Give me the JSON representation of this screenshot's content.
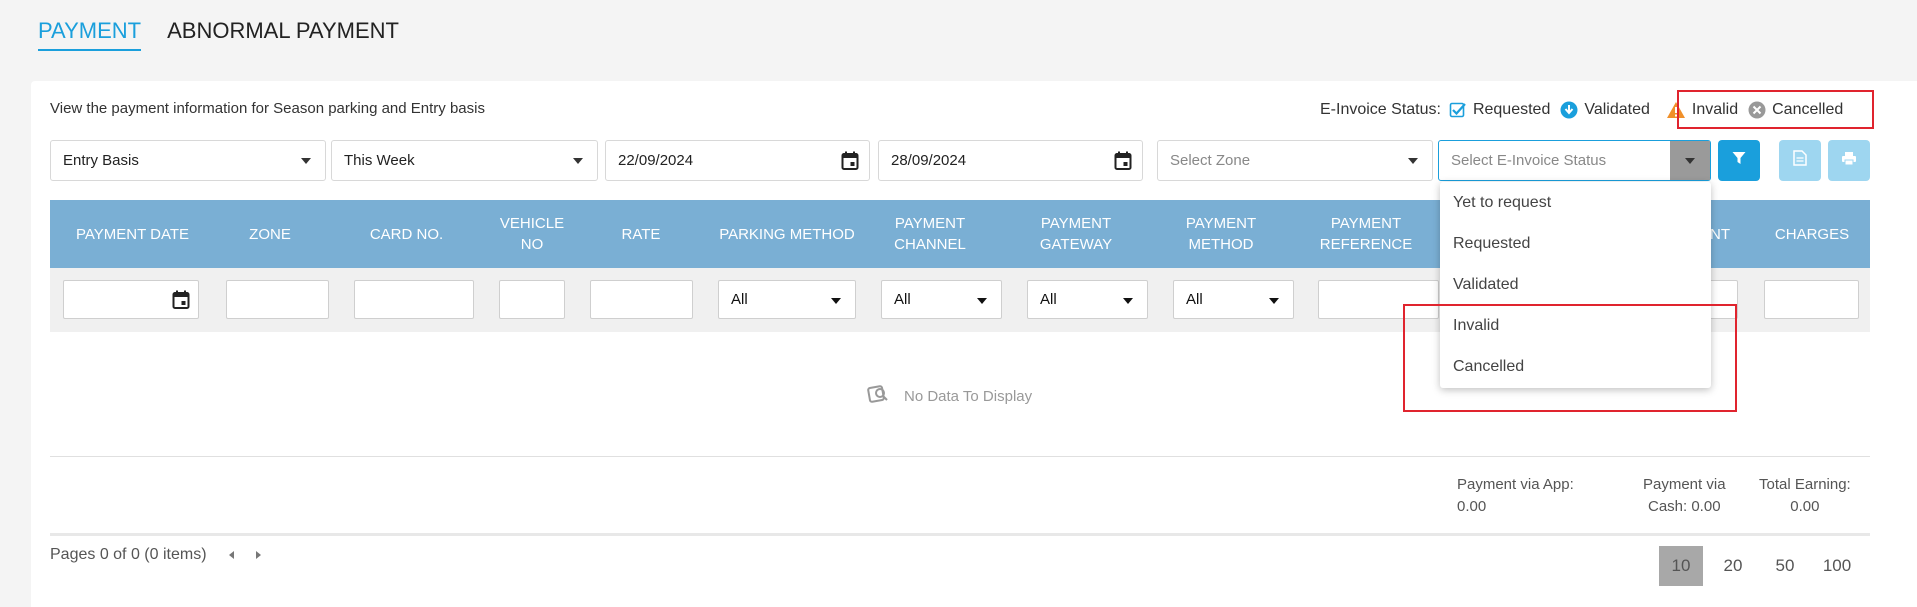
{
  "tabs": [
    {
      "label": "PAYMENT",
      "active": true
    },
    {
      "label": "ABNORMAL PAYMENT",
      "active": false
    }
  ],
  "description": "View the payment information for Season parking and Entry basis",
  "einvoice_legend": {
    "label": "E-Invoice Status:",
    "items": [
      {
        "label": "Requested",
        "icon": "checkbox-icon",
        "color": "#1a9fdc"
      },
      {
        "label": "Validated",
        "icon": "download-circle-icon",
        "color": "#1a9fdc"
      },
      {
        "label": "Invalid",
        "icon": "warning-icon",
        "color": "#f0902a"
      },
      {
        "label": "Cancelled",
        "icon": "x-circle-icon",
        "color": "#999999"
      }
    ]
  },
  "filters": {
    "type": "Entry Basis",
    "period": "This Week",
    "date_from": "22/09/2024",
    "date_to": "28/09/2024",
    "zone_placeholder": "Select Zone",
    "einvoice_placeholder": "Select E-Invoice Status"
  },
  "columns": [
    "PAYMENT DATE",
    "ZONE",
    "CARD NO.",
    "VEHICLE NO",
    "RATE",
    "PARKING METHOD",
    "PAYMENT CHANNEL",
    "PAYMENT GATEWAY",
    "PAYMENT METHOD",
    "PAYMENT REFERENCE",
    "NT",
    "CHARGES"
  ],
  "column_filter_all": "All",
  "no_data": "No Data To Display",
  "summary": {
    "app": {
      "label": "Payment via App:",
      "value": "0.00"
    },
    "cash": {
      "label": "Payment via",
      "label2": "Cash:",
      "value": "0.00"
    },
    "total": {
      "label": "Total Earning:",
      "value": "0.00"
    }
  },
  "pager_text": "Pages 0 of 0 (0 items)",
  "page_sizes": [
    "10",
    "20",
    "50",
    "100"
  ],
  "dropdown_options": [
    "Yet to request",
    "Requested",
    "Validated",
    "Invalid",
    "Cancelled"
  ],
  "colors": {
    "accent": "#1a9fdc",
    "header": "#7aafd4",
    "highlight": "#e0242e"
  }
}
